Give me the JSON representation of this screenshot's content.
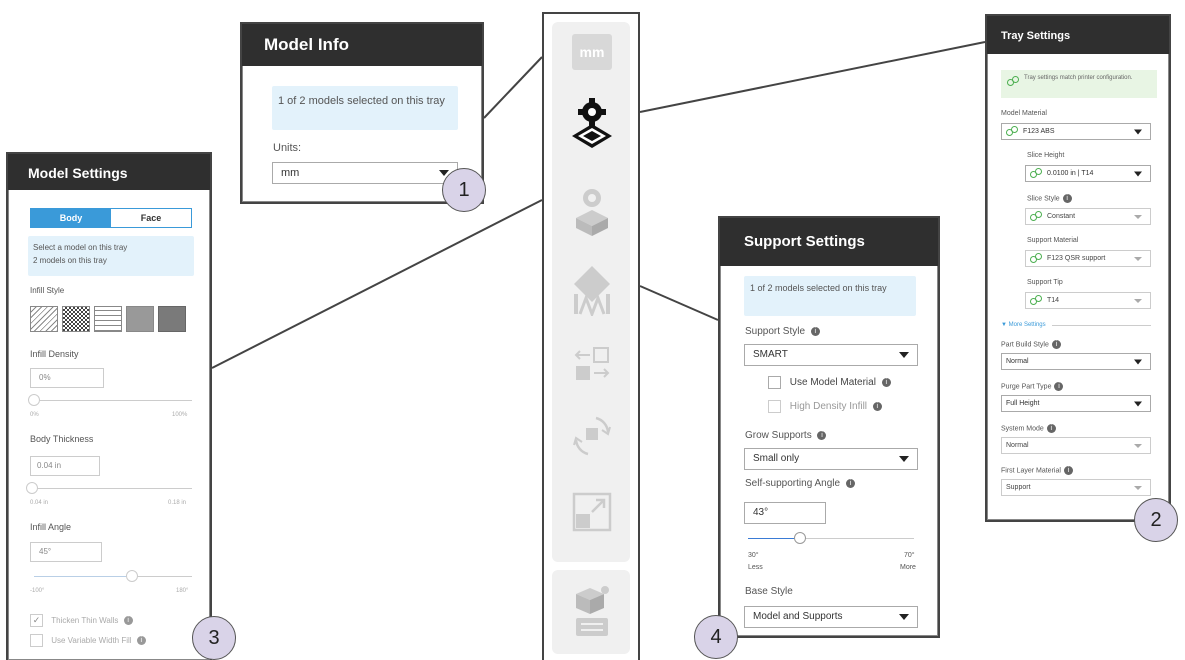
{
  "model_info": {
    "title": "Model Info",
    "selected_text": "1 of 2 models selected on this tray",
    "units_label": "Units:",
    "units_value": "mm"
  },
  "model_settings": {
    "title": "Model Settings",
    "tab_body": "Body",
    "tab_face": "Face",
    "info_line1": "Select a model on this tray",
    "info_line2": "2 models on this tray",
    "infill_style_label": "Infill Style",
    "infill_density_label": "Infill Density",
    "infill_density_value": "0%",
    "density_min": "0%",
    "density_max": "100%",
    "body_thickness_label": "Body Thickness",
    "body_thickness_value": "0.04 in",
    "thickness_min": "0.04 in",
    "thickness_max": "0.18 in",
    "infill_angle_label": "Infill Angle",
    "infill_angle_value": "45°",
    "angle_min": "-100°",
    "angle_max": "180°",
    "thicken_label": "Thicken Thin Walls",
    "variable_label": "Use Variable Width Fill"
  },
  "toolbar": {
    "units_icon_text": "mm"
  },
  "support_settings": {
    "title": "Support Settings",
    "selected_text": "1 of 2 models selected on this tray",
    "support_style_label": "Support Style",
    "support_style_value": "SMART",
    "use_model_material": "Use Model Material",
    "high_density_infill": "High Density Infill",
    "grow_supports_label": "Grow Supports",
    "grow_supports_value": "Small only",
    "self_angle_label": "Self-supporting Angle",
    "self_angle_value": "43°",
    "angle_min": "30°",
    "angle_max": "70°",
    "less_label": "Less",
    "more_label": "More",
    "base_style_label": "Base Style",
    "base_style_value": "Model and Supports"
  },
  "tray_settings": {
    "title": "Tray Settings",
    "match_text": "Tray settings match printer configuration.",
    "model_material_label": "Model Material",
    "model_material_value": "F123 ABS",
    "slice_height_label": "Slice Height",
    "slice_height_value": "0.0100 in | T14",
    "slice_style_label": "Slice Style",
    "slice_style_value": "Constant",
    "support_material_label": "Support Material",
    "support_material_value": "F123 QSR support",
    "support_tip_label": "Support Tip",
    "support_tip_value": "T14",
    "more_settings": "▼ More Settings",
    "part_build_style_label": "Part Build Style",
    "part_build_style_value": "Normal",
    "purge_part_type_label": "Purge Part Type",
    "purge_part_type_value": "Full Height",
    "system_mode_label": "System Mode",
    "system_mode_value": "Normal",
    "first_layer_label": "First Layer Material",
    "first_layer_value": "Support"
  },
  "badges": {
    "b1": "1",
    "b2": "2",
    "b3": "3",
    "b4": "4"
  },
  "colors": {
    "header": "#2f2f2f",
    "accent": "#3a9ad9",
    "info_bg": "#e3f2fb",
    "badge": "#d9d3e8"
  }
}
